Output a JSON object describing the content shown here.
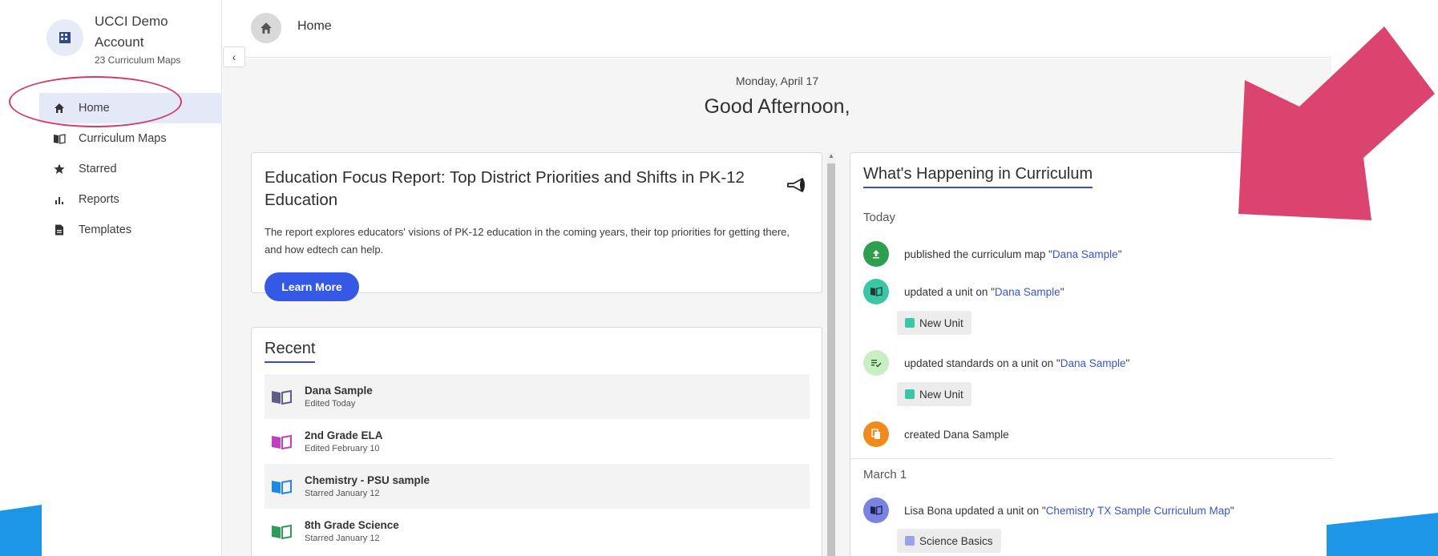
{
  "account": {
    "name": "UCCI Demo Account",
    "subtitle": "23 Curriculum Maps"
  },
  "nav": [
    {
      "label": "Home",
      "icon": "home-icon",
      "active": true
    },
    {
      "label": "Curriculum Maps",
      "icon": "book-icon"
    },
    {
      "label": "Starred",
      "icon": "star-icon"
    },
    {
      "label": "Reports",
      "icon": "bar-chart-icon"
    },
    {
      "label": "Templates",
      "icon": "document-icon"
    }
  ],
  "header": {
    "title": "Home"
  },
  "greeting": {
    "date": "Monday, April 17",
    "text": "Good Afternoon,"
  },
  "focus": {
    "title": "Education Focus Report: Top District Priorities and Shifts in PK-12 Education",
    "description": "The report explores educators' visions of PK-12 education in the coming years, their top priorities for getting there, and how edtech can help.",
    "button": "Learn More"
  },
  "recent": {
    "title": "Recent",
    "items": [
      {
        "title": "Dana Sample",
        "sub": "Edited Today",
        "color": "#5b5f86"
      },
      {
        "title": "2nd Grade ELA",
        "sub": "Edited February 10",
        "color": "#c23fc0"
      },
      {
        "title": "Chemistry - PSU sample",
        "sub": "Starred January 12",
        "color": "#1e88e5"
      },
      {
        "title": "8th Grade Science",
        "sub": "Starred January 12",
        "color": "#2e9e57"
      }
    ]
  },
  "feed": {
    "title": "What's Happening in Curriculum",
    "groups": [
      {
        "day": "Today",
        "items": [
          {
            "pre": "published the curriculum map \"",
            "link": "Dana Sample",
            "post": "\"",
            "color": "#2e9e4f",
            "icon": "upload-icon"
          },
          {
            "pre": "updated a unit on \"",
            "link": "Dana Sample",
            "post": "\"",
            "color": "#3bc6a8",
            "icon": "book-icon",
            "chip": "New Unit",
            "chip_color": "#3bc6a8"
          },
          {
            "pre": "updated standards on a unit on \"",
            "link": "Dana Sample",
            "post": "\"",
            "color": "#c8eec4",
            "icon": "list-check-icon",
            "chip": "New Unit",
            "chip_color": "#3bc6a8"
          },
          {
            "pre": "created Dana Sample",
            "link": "",
            "post": "",
            "color": "#f08a1c",
            "icon": "copy-icon"
          }
        ]
      },
      {
        "day": "March 1",
        "items": [
          {
            "pre": "Lisa Bona updated a unit on \"",
            "link": "Chemistry TX Sample Curriculum Map",
            "post": "\"",
            "color": "#7b83e0",
            "icon": "book-icon",
            "chip": "Science Basics",
            "chip_color": "#9aa2ec"
          }
        ]
      }
    ]
  },
  "colors": {
    "accent": "#3558e6",
    "annotation": "#d43c68",
    "decor_blue": "#1e96e8"
  }
}
